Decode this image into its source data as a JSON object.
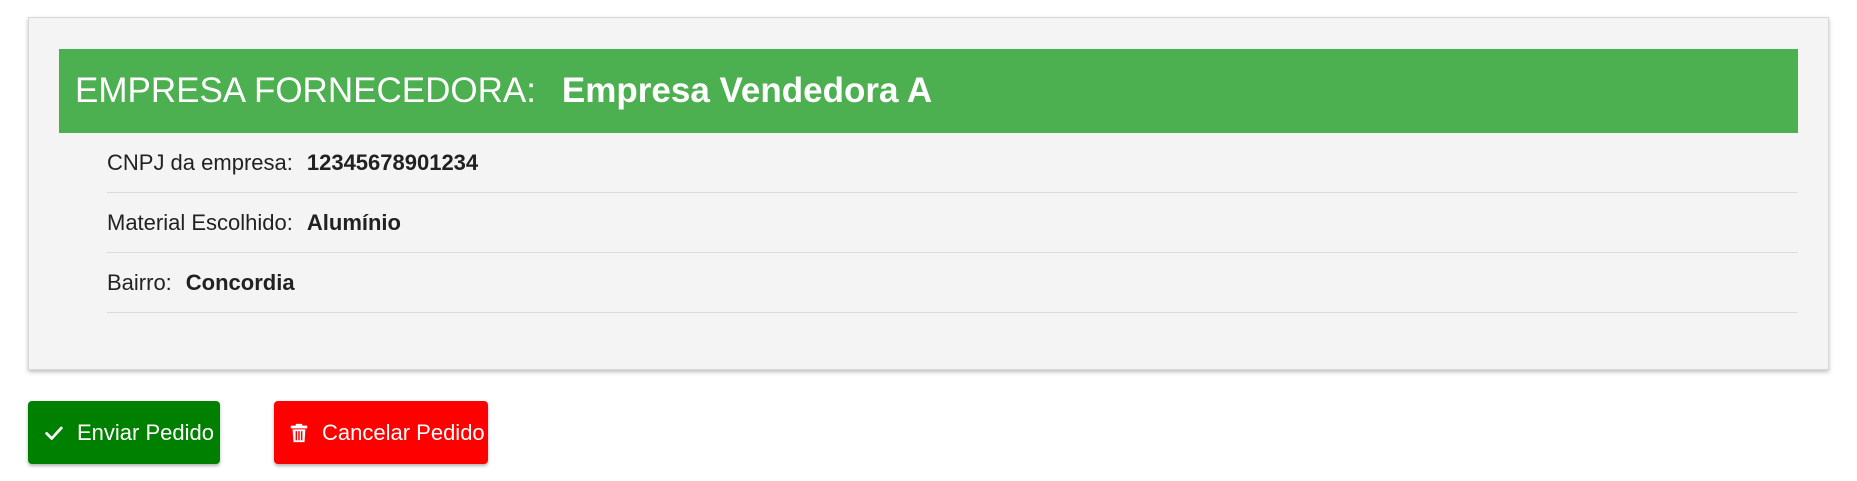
{
  "supplier": {
    "header_label": "EMPRESA FORNECEDORA:",
    "company_name": "Empresa Vendedora A",
    "details": [
      {
        "label": "CNPJ da empresa:",
        "value": "12345678901234"
      },
      {
        "label": "Material Escolhido:",
        "value": "Alumínio"
      },
      {
        "label": "Bairro:",
        "value": "Concordia"
      }
    ]
  },
  "actions": {
    "send": {
      "label": "Enviar Pedido",
      "icon": "check-icon",
      "color": "#008000"
    },
    "cancel": {
      "label": "Cancelar Pedido",
      "icon": "trash-icon",
      "color": "#ff0000"
    }
  },
  "colors": {
    "header_bg": "#4caf50",
    "card_bg": "#f4f4f4"
  }
}
